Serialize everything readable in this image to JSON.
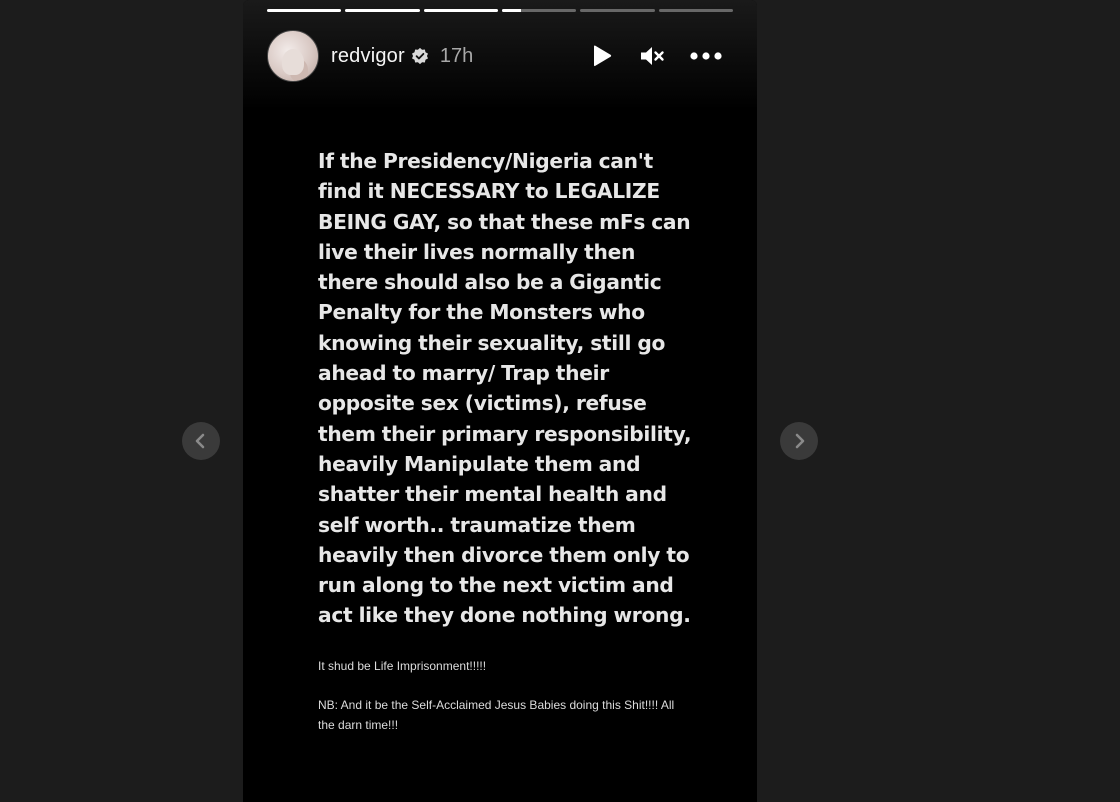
{
  "story": {
    "progress": [
      1,
      1,
      1,
      0.25,
      0,
      0
    ],
    "username": "redvigor",
    "verified": true,
    "time": "17h",
    "main_text": "If the Presidency/Nigeria can't find it NECESSARY to LEGALIZE BEING GAY, so that these mFs can live their lives normally then there should also be a Gigantic Penalty for the Monsters who knowing their sexuality, still go ahead to marry/ Trap their opposite sex (victims), refuse them their primary responsibility, heavily Manipulate them and shatter their mental health and self worth.. traumatize them heavily then divorce them only to run along to the next victim and act like they done nothing wrong.",
    "line_2": "It shud be Life Imprisonment!!!!!",
    "line_3": "NB: And it be the Self-Acclaimed Jesus Babies doing this Shit!!!! All the darn time!!!"
  },
  "icons": {
    "play": "play-icon",
    "mute": "muted-speaker-icon",
    "more": "more-horizontal-icon",
    "prev": "chevron-left-icon",
    "next": "chevron-right-icon",
    "verified": "verified-badge-icon"
  },
  "colors": {
    "page_bg": "#1c1c1c",
    "story_bg": "#000000",
    "nav_button_bg": "#3a3a3a"
  }
}
